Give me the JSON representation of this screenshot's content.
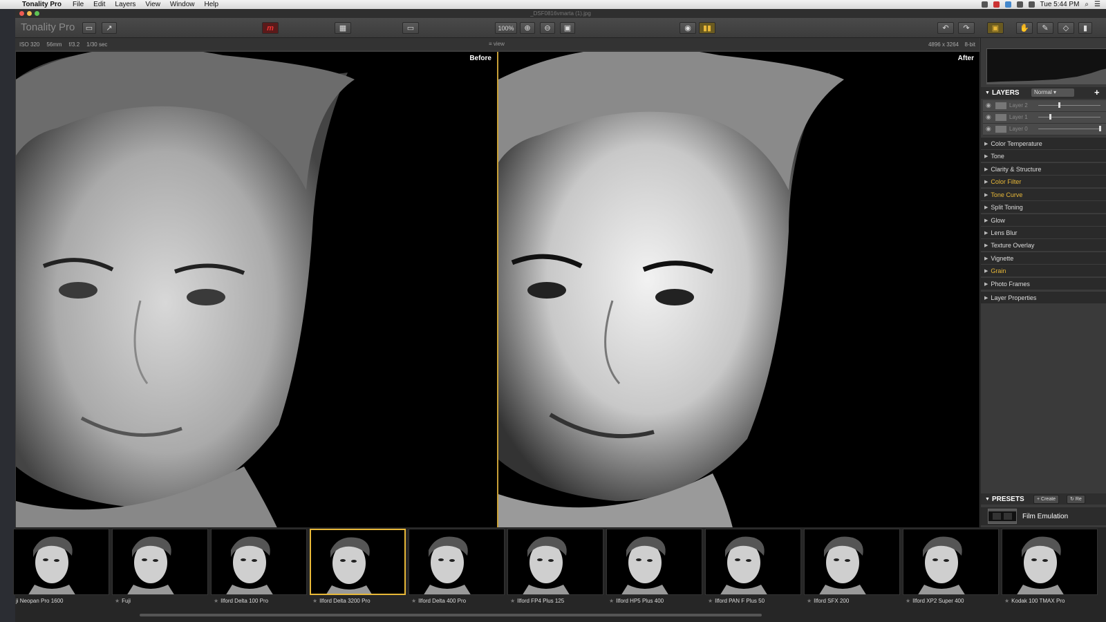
{
  "menubar": {
    "app_name": "Tonality Pro",
    "menus": [
      "File",
      "Edit",
      "Layers",
      "View",
      "Window",
      "Help"
    ],
    "clock": "Tue 5:44 PM"
  },
  "window": {
    "title": "_DSF0816vmarta (1).jpg",
    "app_logo": "Tonality Pro"
  },
  "toolbar": {
    "zoom_level": "100%"
  },
  "infobar": {
    "iso": "ISO 320",
    "focal": "56mm",
    "aperture": "f/3.2",
    "shutter": "1/30 sec",
    "view_label": "view",
    "dimensions": "4896 x 3264",
    "bitdepth": "8-bit"
  },
  "compare": {
    "before_label": "Before",
    "after_label": "After",
    "divider_color": "#c8a037"
  },
  "layers": {
    "title": "LAYERS",
    "blend_mode": "Normal",
    "items": [
      {
        "name": "Layer 2",
        "opacity": 0.33
      },
      {
        "name": "Layer 1",
        "opacity": 0.18
      },
      {
        "name": "Layer 0",
        "opacity": 1.0
      }
    ]
  },
  "adjustments": [
    {
      "label": "Color Temperature",
      "active": false
    },
    {
      "label": "Tone",
      "active": false
    },
    {
      "label": "Clarity & Structure",
      "active": false
    },
    {
      "label": "Color Filter",
      "active": true
    },
    {
      "label": "Tone Curve",
      "active": true
    },
    {
      "label": "Split Toning",
      "active": false
    },
    {
      "label": "Glow",
      "active": false
    },
    {
      "label": "Lens Blur",
      "active": false
    },
    {
      "label": "Texture Overlay",
      "active": false
    },
    {
      "label": "Vignette",
      "active": false
    },
    {
      "label": "Grain",
      "active": true
    },
    {
      "label": "Photo Frames",
      "active": false
    },
    {
      "label": "Layer Properties",
      "active": false
    }
  ],
  "presets": {
    "title": "PRESETS",
    "create_label": "Create",
    "reset_label": "Re",
    "category": "Film Emulation",
    "accent_color": "#e8b838"
  },
  "filmstrip": [
    {
      "label": "ji Neopan Pro 1600",
      "selected": false
    },
    {
      "label": "Fuji",
      "selected": false
    },
    {
      "label": "Ilford Delta 100 Pro",
      "selected": false
    },
    {
      "label": "Ilford Delta 3200 Pro",
      "selected": true
    },
    {
      "label": "Ilford Delta 400 Pro",
      "selected": false
    },
    {
      "label": "Ilford FP4 Plus 125",
      "selected": false
    },
    {
      "label": "Ilford HP5 Plus 400",
      "selected": false
    },
    {
      "label": "Ilford PAN F Plus 50",
      "selected": false
    },
    {
      "label": "Ilford SFX 200",
      "selected": false
    },
    {
      "label": "Ilford XP2 Super 400",
      "selected": false
    },
    {
      "label": "Kodak 100 TMAX Pro",
      "selected": false
    }
  ]
}
